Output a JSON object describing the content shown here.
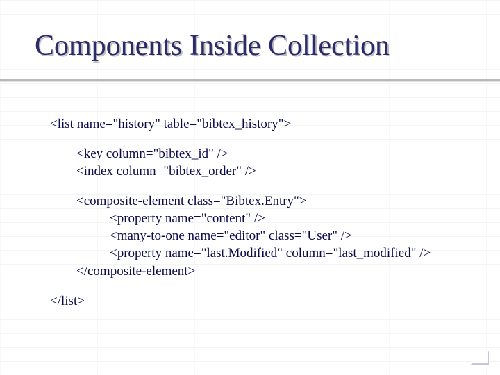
{
  "title": "Components Inside Collection",
  "code": {
    "line1": "<list name=\"history\" table=\"bibtex_history\">",
    "line2": "<key column=\"bibtex_id\" />",
    "line3": "<index column=\"bibtex_order\" />",
    "line4": "<composite-element class=\"Bibtex.Entry\">",
    "line5": "<property name=\"content\" />",
    "line6": "<many-to-one name=\"editor\" class=\"User\" />",
    "line7": "<property name=\"last.Modified\" column=\"last_modified\" />",
    "line8": "</composite-element>",
    "line9": "</list>"
  }
}
